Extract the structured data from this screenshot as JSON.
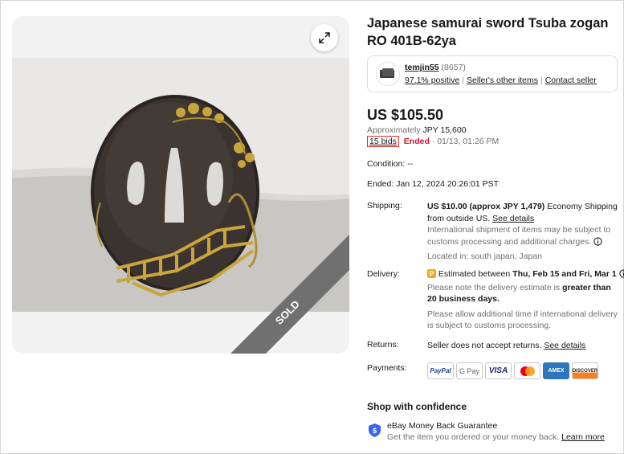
{
  "listing": {
    "title": "Japanese samurai sword Tsuba zogan RO 401B-62ya",
    "sold_label": "SOLD"
  },
  "seller": {
    "name": "temjin55",
    "score": "(8657)",
    "positive": "97.1% positive",
    "other_items": "Seller's other items",
    "contact": "Contact seller"
  },
  "price": {
    "main": "US $105.50",
    "approx_prefix": "Approximately",
    "approx_value": "JPY 15,600",
    "bids": "15 bids",
    "status": "Ended",
    "end_short": "· 01/13, 01:26 PM"
  },
  "condition": {
    "label": "Condition:",
    "value": "--"
  },
  "ended": {
    "label": "Ended:",
    "value": "Jan 12, 2024 20:26:01 PST"
  },
  "shipping": {
    "label": "Shipping:",
    "main": "US $10.00 (approx JPY 1,479)",
    "method": "Economy Shipping from outside US.",
    "see_details": "See details",
    "note": "International shipment of items may be subject to customs processing and additional charges.",
    "location": "Located in: south japan, Japan"
  },
  "delivery": {
    "label": "Delivery:",
    "prefix": "Estimated between",
    "dates": "Thu, Feb 15 and Fri, Mar 1",
    "note_prefix": "Please note the delivery estimate is",
    "note_bold": "greater than 20 business days.",
    "note2": "Please allow additional time if international delivery is subject to customs processing."
  },
  "returns": {
    "label": "Returns:",
    "value": "Seller does not accept returns.",
    "see_details": "See details"
  },
  "payments": {
    "label": "Payments:",
    "methods": [
      "PayPal",
      "G Pay",
      "VISA",
      "Mastercard",
      "AMEX",
      "DISCOVER"
    ]
  },
  "confidence": {
    "title": "Shop with confidence",
    "guarantee": "eBay Money Back Guarantee",
    "guarantee_sub": "Get the item you ordered or your money back.",
    "learn_more": "Learn more"
  },
  "colors": {
    "ended_red": "#e0102d",
    "highlight_box": "#e02e2e",
    "sold_ribbon": "#707070",
    "shield_blue": "#3665f3"
  },
  "icons": [
    "expand-icon",
    "info-icon",
    "shield-icon",
    "delivery-badge-icon",
    "seller-avatar-icon"
  ]
}
